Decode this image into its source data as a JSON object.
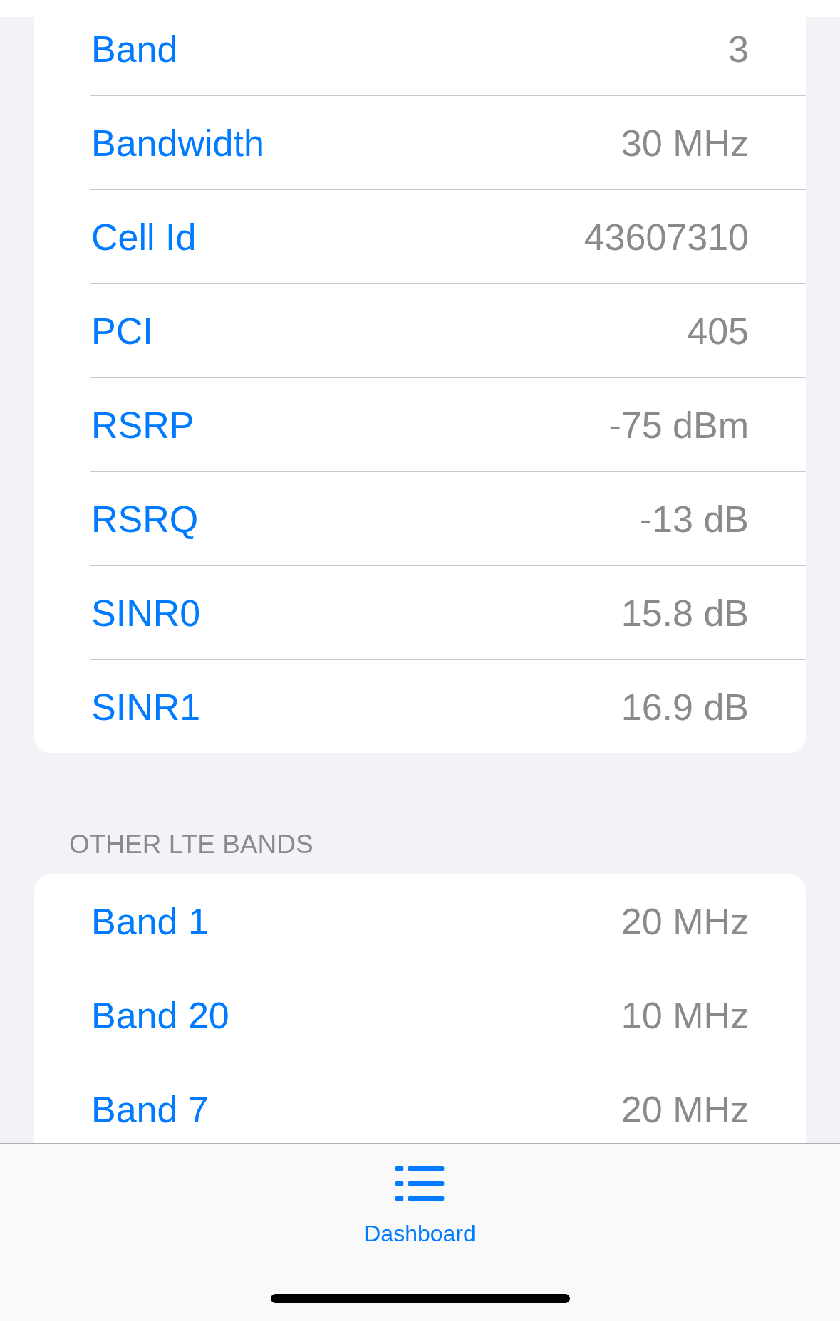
{
  "sections": [
    {
      "rows": [
        {
          "label": "Band",
          "value": "3"
        },
        {
          "label": "Bandwidth",
          "value": "30 MHz"
        },
        {
          "label": "Cell Id",
          "value": "43607310"
        },
        {
          "label": "PCI",
          "value": "405"
        },
        {
          "label": "RSRP",
          "value": "-75 dBm"
        },
        {
          "label": "RSRQ",
          "value": "-13 dB"
        },
        {
          "label": "SINR0",
          "value": "15.8 dB"
        },
        {
          "label": "SINR1",
          "value": "16.9 dB"
        }
      ]
    },
    {
      "header": "OTHER LTE BANDS",
      "rows": [
        {
          "label": "Band 1",
          "value": "20 MHz"
        },
        {
          "label": "Band 20",
          "value": "10 MHz"
        },
        {
          "label": "Band 7",
          "value": "20 MHz"
        }
      ]
    }
  ],
  "tab_bar": {
    "tabs": [
      {
        "label": "Dashboard",
        "selected": true
      }
    ]
  }
}
